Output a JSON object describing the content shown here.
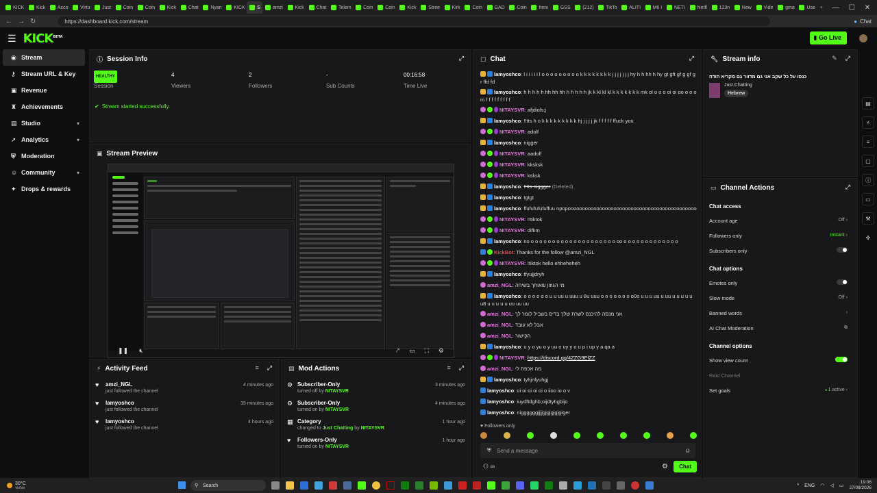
{
  "browser": {
    "tabs": [
      "KICK",
      "Kick",
      "Acco",
      "Virtu",
      "Just",
      "Coin",
      "Coin",
      "Kick",
      "Chat",
      "Nyan",
      "KICK",
      "S",
      "amzi",
      "Kick",
      "Chat",
      "Telem",
      "Coin",
      "Coin",
      "Kick",
      "Stree",
      "Kirk",
      "Coin",
      "GAD",
      "Coin",
      "Item",
      "GSS",
      "(212)",
      "TikTo",
      "ALITI",
      "M6 I",
      "NETI",
      "Netfl",
      "123n",
      "New",
      "Vide",
      "gma",
      "Use"
    ],
    "active_tab_index": 11,
    "url": "https://dashboard.kick.com/stream",
    "chat_button": "Chat"
  },
  "header": {
    "logo": "KICK",
    "logo_sup": "BETA",
    "go_live": "Go Live"
  },
  "sidebar": {
    "items": [
      {
        "label": "Stream",
        "icon": "broadcast-icon",
        "glyph": "◉",
        "active": true,
        "chevron": false
      },
      {
        "label": "Stream URL & Key",
        "icon": "key-icon",
        "glyph": "⚷",
        "active": false,
        "chevron": false
      },
      {
        "label": "Revenue",
        "icon": "revenue-icon",
        "glyph": "▣",
        "active": false,
        "chevron": false
      },
      {
        "label": "Achievements",
        "icon": "trophy-icon",
        "glyph": "♜",
        "active": false,
        "chevron": false
      },
      {
        "label": "Studio",
        "icon": "studio-icon",
        "glyph": "▤",
        "active": false,
        "chevron": true
      },
      {
        "label": "Analytics",
        "icon": "analytics-icon",
        "glyph": "➚",
        "active": false,
        "chevron": true
      },
      {
        "label": "Moderation",
        "icon": "shield-icon",
        "glyph": "⛨",
        "active": false,
        "chevron": false
      },
      {
        "label": "Community",
        "icon": "community-icon",
        "glyph": "☺",
        "active": false,
        "chevron": true
      },
      {
        "label": "Drops & rewards",
        "icon": "gift-icon",
        "glyph": "✦",
        "active": false,
        "chevron": false
      }
    ]
  },
  "session": {
    "title": "Session Info",
    "health": "HEALTHY",
    "stats": [
      {
        "value": "",
        "label": "Session"
      },
      {
        "value": "4",
        "label": "Viewers"
      },
      {
        "value": "2",
        "label": "Followers"
      },
      {
        "value": "-",
        "label": "Sub Counts"
      },
      {
        "value": "00:16:58",
        "label": "Time Live"
      }
    ],
    "success": "Stream started successfully."
  },
  "preview": {
    "title": "Stream Preview"
  },
  "activity": {
    "title": "Activity Feed",
    "items": [
      {
        "name": "amzi_NGL",
        "sub": "just followed the channel",
        "time": "4 minutes ago"
      },
      {
        "name": "lamyoshco",
        "sub": "just followed the channel",
        "time": "35 minutes ago"
      },
      {
        "name": "lamyoshco",
        "sub": "just followed the channel",
        "time": "4 hours ago"
      }
    ]
  },
  "modactions": {
    "title": "Mod Actions",
    "items": [
      {
        "name": "Subscriber-Only",
        "pre": "turned off by",
        "highlight": "NITAYSVR",
        "mid": "",
        "by": "",
        "time": "3 minutes ago",
        "icon": "settings-icon"
      },
      {
        "name": "Subscriber-Only",
        "pre": "turned on by",
        "highlight": "NITAYSVR",
        "mid": "",
        "by": "",
        "time": "4 minutes ago",
        "icon": "settings-icon"
      },
      {
        "name": "Category",
        "pre": "changed to",
        "highlight": "Just Chatting",
        "mid": "by",
        "by": "NITAYSVR",
        "time": "1 hour ago",
        "icon": "category-icon"
      },
      {
        "name": "Followers-Only",
        "pre": "turned on by",
        "highlight": "NITAYSVR",
        "mid": "",
        "by": "",
        "time": "1 hour ago",
        "icon": "heart-icon"
      }
    ]
  },
  "chat": {
    "title": "Chat",
    "messages": [
      {
        "badges": [
          "crown",
          "mod"
        ],
        "user": "lamyoshco",
        "ucls": "",
        "text": "l i i i i i l o o o o o o o o o k k k k k k k k j j j j j j j hy h h hh h hy gt gft gf g gf g r ffd fd",
        "wrap": true
      },
      {
        "badges": [
          "crown",
          "mod"
        ],
        "user": "lamyoshco",
        "ucls": "",
        "text": "h h h h h hh hh hh h h h h h jk k kl kl kl k k k k k k k mk ol o o o oi oi oo o o o m f f f f f f f f f",
        "wrap": true
      },
      {
        "badges": [
          "pink",
          "green",
          "purple"
        ],
        "user": "NITAYSVR",
        "ucls": "pink",
        "text": "afjdiols;j",
        "wrap": false
      },
      {
        "badges": [
          "crown",
          "mod"
        ],
        "user": "lamyoshco",
        "ucls": "",
        "text": "!!tts h o k k k k k k k k k hj j j j j jk f f f f f ffuck you",
        "wrap": false
      },
      {
        "badges": [
          "pink",
          "green",
          "purple"
        ],
        "user": "NITAYSVR",
        "ucls": "pink",
        "text": "adolf",
        "wrap": false
      },
      {
        "badges": [
          "crown",
          "mod"
        ],
        "user": "lamyoshco",
        "ucls": "",
        "text": "nigger",
        "wrap": false
      },
      {
        "badges": [
          "pink",
          "green",
          "purple"
        ],
        "user": "NITAYSVR",
        "ucls": "pink",
        "text": "aadolf",
        "wrap": false
      },
      {
        "badges": [
          "pink",
          "green",
          "purple"
        ],
        "user": "NITAYSVR",
        "ucls": "pink",
        "text": "kksksk",
        "wrap": false
      },
      {
        "badges": [
          "pink",
          "green",
          "purple"
        ],
        "user": "NITAYSVR",
        "ucls": "pink",
        "text": "ksksk",
        "wrap": false
      },
      {
        "badges": [
          "crown",
          "mod"
        ],
        "user": "lamyoshco",
        "ucls": "",
        "text": "!!tts niggger",
        "deleted": "(Deleted)",
        "wrap": false
      },
      {
        "badges": [
          "crown",
          "mod"
        ],
        "user": "lamyoshco",
        "ucls": "",
        "text": "tgtgt",
        "wrap": false
      },
      {
        "badges": [
          "crown",
          "mod"
        ],
        "user": "lamyoshco",
        "ucls": "",
        "text": "ffufufufufuffuu npopoooooooooooooooooooooooooooooooooooooooooooooooo",
        "wrap": false
      },
      {
        "badges": [
          "pink",
          "green",
          "purple"
        ],
        "user": "NITAYSVR",
        "ucls": "pink",
        "text": "!!tiktok",
        "wrap": false
      },
      {
        "badges": [
          "pink",
          "green",
          "purple"
        ],
        "user": "NITAYSVR",
        "ucls": "pink",
        "text": "difkm",
        "wrap": false
      },
      {
        "badges": [
          "crown",
          "mod"
        ],
        "user": "lamyoshco",
        "ucls": "",
        "text": "no o o o o o o o o o o o o o o o o o o o o oo o o o o o o o o o o o o o",
        "wrap": false
      },
      {
        "badges": [
          "mod",
          "green"
        ],
        "user": "KickBot",
        "ucls": "red",
        "text": "Thanks for the follow @amzi_NGL",
        "wrap": false
      },
      {
        "badges": [
          "pink",
          "green",
          "purple"
        ],
        "user": "NITAYSVR",
        "ucls": "pink",
        "text": "!tiktok hello ehheheheh",
        "wrap": false
      },
      {
        "badges": [
          "crown",
          "mod"
        ],
        "user": "lamyoshco",
        "ucls": "",
        "text": "tfyujjdryh",
        "wrap": false
      },
      {
        "badges": [
          "pink"
        ],
        "user": "amzi_NGL",
        "ucls": "pink",
        "text": "מי הגוזון שאוחך בשיחה",
        "wrap": false
      },
      {
        "badges": [
          "crown",
          "mod"
        ],
        "user": "lamyoshco",
        "ucls": "",
        "text": "o o o o o o u u uu u uuu u 8u uuu o o o o o o o o0o u u u uu u uu u u u u u u8 u u u u u uu uu uu",
        "wrap": true
      },
      {
        "badges": [
          "pink"
        ],
        "user": "amzi_NGL",
        "ucls": "pink",
        "text": "אני מנסה להיכנס לשרת שלך בדיס בשביל לומר לך",
        "wrap": false
      },
      {
        "badges": [
          "pink"
        ],
        "user": "amzi_NGL",
        "ucls": "pink",
        "text": "אבל לא עובד",
        "wrap": false
      },
      {
        "badges": [
          "pink"
        ],
        "user": "amzi_NGL",
        "ucls": "pink",
        "text": "הקישור",
        "wrap": false
      },
      {
        "badges": [
          "crown",
          "mod"
        ],
        "user": "lamyoshco",
        "ucls": "",
        "text": "u y o yu o y uu o uy y o u p i up y a qa a",
        "wrap": false
      },
      {
        "badges": [
          "pink",
          "green",
          "purple"
        ],
        "user": "NITAYSVR",
        "ucls": "pink",
        "text": "",
        "link": "https://discord.gg/4ZZG9EfZZ",
        "wrap": false
      },
      {
        "badges": [
          "pink"
        ],
        "user": "amzi_NGL",
        "ucls": "pink",
        "text": "מה אכפת לי",
        "wrap": false
      },
      {
        "badges": [
          "crown",
          "mod"
        ],
        "user": "lamyoshco",
        "ucls": "",
        "text": "tyhjnfyuhgj",
        "wrap": false
      },
      {
        "badges": [
          "mod"
        ],
        "user": "lamyoshco",
        "ucls": "",
        "text": "oi oi oi oi oi o iioo io o v",
        "wrap": false
      },
      {
        "badges": [
          "mod"
        ],
        "user": "lamyoshco",
        "ucls": "",
        "text": "iuydftdghb;oijdtyhgbijo",
        "wrap": false
      },
      {
        "badges": [
          "mod"
        ],
        "user": "lamyoshco",
        "ucls": "",
        "text": "niggggggjjjjgjgjgjgjgiger",
        "wrap": false
      }
    ],
    "followers_only": "Followers only",
    "placeholder": "Send a message",
    "send": "Chat"
  },
  "streaminfo": {
    "title": "Stream info",
    "stream_title": "כנסו על כל שקב אני גם מדוור גם מקריא הודה",
    "category": "Just Chatting",
    "tag": "Hebrew"
  },
  "channel": {
    "title": "Channel Actions",
    "sections": [
      {
        "heading": "Chat access",
        "rows": [
          {
            "label": "Account age",
            "value": "Off",
            "kind": "chev"
          },
          {
            "label": "Followers only",
            "value": "Instant",
            "kind": "chev-green"
          },
          {
            "label": "Subscribers only",
            "value": "",
            "kind": "toggle-off"
          }
        ]
      },
      {
        "heading": "Chat options",
        "rows": [
          {
            "label": "Emotes only",
            "value": "",
            "kind": "toggle-off"
          },
          {
            "label": "Slow mode",
            "value": "Off",
            "kind": "chev"
          },
          {
            "label": "Banned words",
            "value": "",
            "kind": "chev"
          },
          {
            "label": "AI Chat Moderation",
            "value": "",
            "kind": "ext"
          }
        ]
      },
      {
        "heading": "Channel options",
        "rows": [
          {
            "label": "Show view count",
            "value": "",
            "kind": "toggle-on"
          },
          {
            "label": "Raid Channel",
            "value": "",
            "kind": "dim"
          },
          {
            "label": "Set goals",
            "value": "1 active",
            "kind": "chev-dot"
          }
        ]
      }
    ]
  },
  "taskbar": {
    "temp": "30°C",
    "weather": "שמשי",
    "search": "Search",
    "lang": "ENG",
    "time": "19:06",
    "date": "27/08/2026"
  },
  "colors": {
    "accent": "#53fc18",
    "bg": "#0e0e10",
    "panel": "#18181b"
  }
}
